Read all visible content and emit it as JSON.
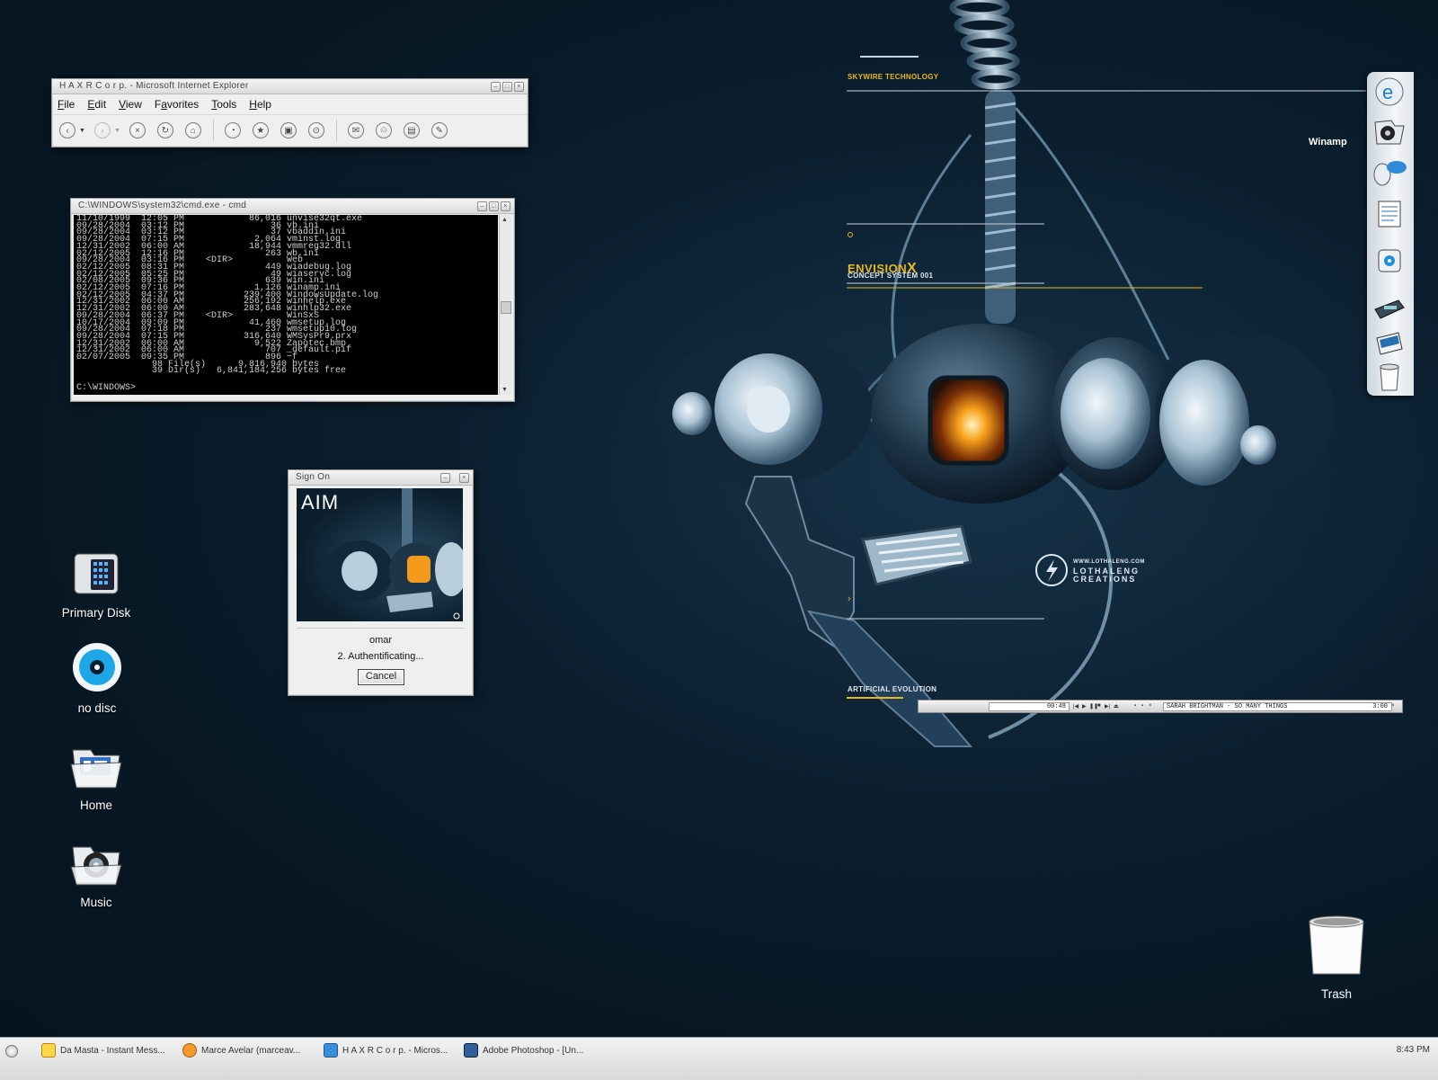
{
  "wallpaper": {
    "heading_top": "SKYWIRE TECHNOLOGY",
    "brand": "ENVISION",
    "brand_x": "X",
    "brand_sub": "CONCEPT SYSTEM 001",
    "logo_url": "WWW.LOTHALENG.COM",
    "logo_line1": "LOTHALENG",
    "logo_line2": "CREATIONS",
    "heading_bottom": "ARTIFICIAL EVOLUTION"
  },
  "ie": {
    "title": "H A X R C o r p. - Microsoft Internet Explorer",
    "menus": [
      {
        "pre": "",
        "u": "F",
        "post": "ile"
      },
      {
        "pre": "",
        "u": "E",
        "post": "dit"
      },
      {
        "pre": "",
        "u": "V",
        "post": "iew"
      },
      {
        "pre": "F",
        "u": "a",
        "post": "vorites"
      },
      {
        "pre": "",
        "u": "T",
        "post": "ools"
      },
      {
        "pre": "",
        "u": "H",
        "post": "elp"
      }
    ]
  },
  "cmd": {
    "title": "C:\\WINDOWS\\system32\\cmd.exe - cmd",
    "lines": [
      "11/10/1999  12:05 PM            86,016 unvise32qt.exe",
      "09/28/2004  03:12 PM                36 vb.ini",
      "09/28/2004  03:12 PM                37 vbaddin.ini",
      "09/28/2004  07:15 PM             2,064 vminst.log",
      "12/31/2002  06:00 AM            18,944 vmmreg32.dll",
      "02/12/2005  12:16 PM               263 wb.ini",
      "09/28/2004  03:16 PM    <DIR>          Web",
      "02/12/2005  08:31 PM               449 wiadebug.log",
      "02/12/2005  05:25 PM                49 wiaservc.log",
      "02/08/2005  09:36 PM               639 win.ini",
      "02/12/2005  07:16 PM             1,126 winamp.ini",
      "02/12/2005  04:37 PM           239,400 WindowsUpdate.log",
      "12/31/2002  06:00 AM           256,192 winhelp.exe",
      "12/31/2002  06:00 AM           283,648 winhlp32.exe",
      "09/28/2004  06:37 PM    <DIR>          WinSxS",
      "10/17/2004  09:09 PM            41,460 wmsetup.log",
      "09/28/2004  07:18 PM               237 wmsetup10.log",
      "09/28/2004  07:15 PM           316,640 WMSysPr9.prx",
      "12/31/2002  06:00 AM             9,522 Zapotec.bmp",
      "12/31/2002  06:00 AM               707 _default.pif",
      "02/07/2005  09:35 PM               896 ~f",
      "              98 File(s)      9,816,940 bytes",
      "              39 Dir(s)   6,841,184,256 bytes free"
    ],
    "prompt": "C:\\WINDOWS>"
  },
  "aim": {
    "title": "Sign On",
    "logo": "AIM",
    "screen_name": "omar",
    "status": "2. Authentificating...",
    "cancel_label": "Cancel"
  },
  "desktop_icons": [
    {
      "label": "Primary Disk",
      "icon": "hard-disk-icon"
    },
    {
      "label": "no disc",
      "icon": "optical-disc-icon"
    },
    {
      "label": "Home",
      "icon": "home-folder-icon"
    },
    {
      "label": "Music",
      "icon": "music-folder-icon"
    }
  ],
  "dock": {
    "tooltip": "Winamp",
    "items": [
      "internet-explorer-icon",
      "winamp-icon",
      "instant-messenger-icon",
      "documents-icon",
      "media-icon",
      "tools-icon",
      "scanner-icon",
      "trash-icon"
    ]
  },
  "winamp": {
    "time": "00:48",
    "track": "SARAH BRIGHTMAN - SO MANY THINGS",
    "length": "3:00"
  },
  "trash": {
    "label": "Trash"
  },
  "taskbar": {
    "tasks": [
      {
        "label": "Da Masta - Instant Mess...",
        "icon": "aim-icon"
      },
      {
        "label": "Marce Avelar (marceav...",
        "icon": "messenger-icon"
      },
      {
        "label": "H A X R C o r p. - Micros...",
        "icon": "internet-explorer-icon"
      },
      {
        "label": "Adobe Photoshop - [Un...",
        "icon": "photoshop-icon"
      }
    ],
    "clock": "8:43 PM"
  },
  "colors": {
    "wallpaper": "#071723",
    "accent_yellow": "#e8b820",
    "window_chrome": "#efefef"
  }
}
